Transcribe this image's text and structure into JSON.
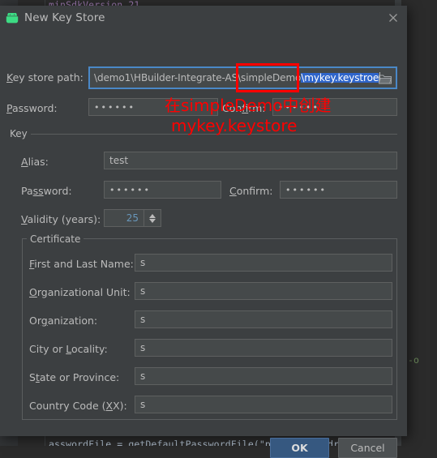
{
  "background": {
    "top_code": "minSdkVersion 21",
    "right_code": "d-o",
    "bottom_code": "asswordFile = getDefaultPasswordFile(\"password.android"
  },
  "dialog": {
    "title": "New Key Store",
    "icon": "android-robot-icon",
    "close_icon": "close-icon",
    "keystore": {
      "path_label": "Key store path:",
      "path_label_mnemonic": "K",
      "path_value_plain": "\\demo1\\HBuilder-Integrate-AS\\simpleDemo",
      "path_value_selected": "\\mykey.keystroe",
      "browse_icon": "folder-icon",
      "password_label": "Password:",
      "password_label_mnemonic": "P",
      "password_value": "••••••",
      "confirm_label": "Confirm:",
      "confirm_label_mnemonic": "f",
      "confirm_value": "••••••"
    },
    "key_group": {
      "legend": "Key",
      "alias_label": "Alias:",
      "alias_label_mnemonic": "A",
      "alias_value": "test",
      "password_label": "Password:",
      "password_label_mnemonic": "ss",
      "password_value": "••••••",
      "confirm_label": "Confirm:",
      "confirm_label_mnemonic": "C",
      "confirm_value": "••••••",
      "validity_label": "Validity (years):",
      "validity_label_mnemonic": "V",
      "validity_value": "25",
      "spinner_up_icon": "chevron-up-icon",
      "spinner_down_icon": "chevron-down-icon"
    },
    "certificate_group": {
      "legend": "Certificate",
      "rows": [
        {
          "label": "First and Last Name:",
          "mnemonic": "F",
          "value": "s"
        },
        {
          "label": "Organizational Unit:",
          "mnemonic": "O",
          "value": "s"
        },
        {
          "label": "Organization:",
          "mnemonic": "g",
          "value": "s"
        },
        {
          "label": "City or Locality:",
          "mnemonic": "L",
          "value": "s"
        },
        {
          "label": "State or Province:",
          "mnemonic": "t",
          "value": "s"
        },
        {
          "label": "Country Code (XX):",
          "mnemonic": "X",
          "value": "s"
        }
      ]
    },
    "buttons": {
      "ok": "OK",
      "cancel": "Cancel"
    }
  },
  "annotation": {
    "line1": "在simpleDemo中创建",
    "line2": "mykey.keystore",
    "color": "#ff0000",
    "box_color": "#ff0000"
  }
}
